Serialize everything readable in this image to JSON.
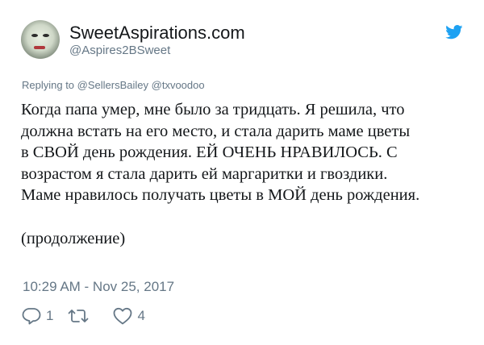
{
  "user": {
    "display_name": "SweetAspirations.com",
    "handle": "@Aspires2BSweet"
  },
  "reply": {
    "prefix": "Replying to",
    "mentions": [
      "@SellersBailey",
      "@txvoodoo"
    ]
  },
  "body": {
    "lines": [
      "Когда папа умер, мне было за тридцать. Я решила, что",
      "должна встать на его место, и стала дарить маме цветы",
      "в СВОЙ день рождения. ЕЙ ОЧЕНЬ НРАВИЛОСЬ. С",
      "возрастом я стала дарить ей маргаритки и гвоздики.",
      "Маме нравилось получать цветы в МОЙ день рождения."
    ],
    "continuation": "(продолжение)"
  },
  "timestamp": "10:29 AM - Nov 25, 2017",
  "actions": {
    "replies": "1",
    "retweets": "",
    "likes": "4"
  },
  "icons": {
    "brand": "twitter-bird-icon",
    "reply": "reply-icon",
    "retweet": "retweet-icon",
    "like": "heart-icon"
  },
  "colors": {
    "twitter_blue": "#1da1f2",
    "secondary_text": "#657786",
    "primary_text": "#14171a"
  }
}
